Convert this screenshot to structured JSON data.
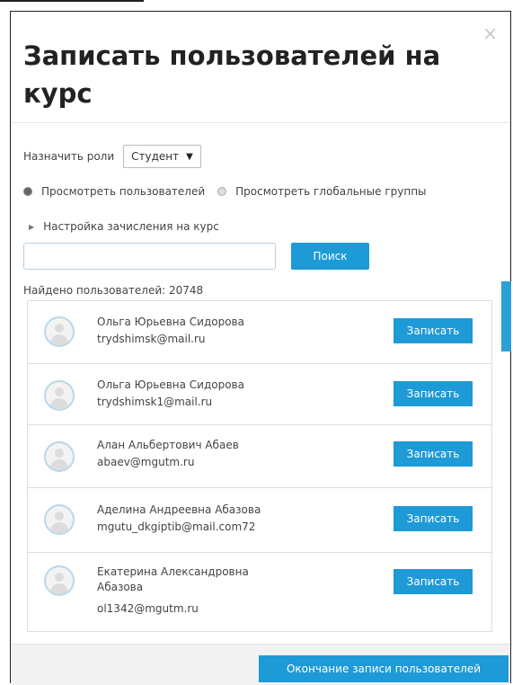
{
  "dialog": {
    "title": "Записать пользователей на курс",
    "close_icon": "close-icon"
  },
  "roles": {
    "label": "Назначить роли",
    "selected": "Студент"
  },
  "view_options": [
    {
      "label": "Просмотреть пользователей",
      "checked": true
    },
    {
      "label": "Просмотреть глобальные группы",
      "checked": false
    }
  ],
  "settings_toggle": "Настройка зачисления на курс",
  "search": {
    "value": "",
    "button": "Поиск"
  },
  "found_count": "Найдено пользователей: 20748",
  "users": [
    {
      "name": "Ольга Юрьевна Сидорова",
      "email": "trydshimsk@mail.ru",
      "button": "Записать"
    },
    {
      "name": "Ольга Юрьевна Сидорова",
      "email": "trydshimsk1@mail.ru",
      "button": "Записать"
    },
    {
      "name": "Алан Альбертович Абаев",
      "email": "abaev@mgutm.ru",
      "button": "Записать"
    },
    {
      "name": "Аделина Андреевна Абазова",
      "email": "mgutu_dkgiptib@mail.com72",
      "button": "Записать"
    },
    {
      "name": "Екатерина Александровна Абазова",
      "email": "ol1342@mgutm.ru",
      "button": "Записать"
    }
  ],
  "footer": {
    "finish_button": "Окончание записи пользователей"
  },
  "colors": {
    "accent": "#1e9ad6"
  }
}
